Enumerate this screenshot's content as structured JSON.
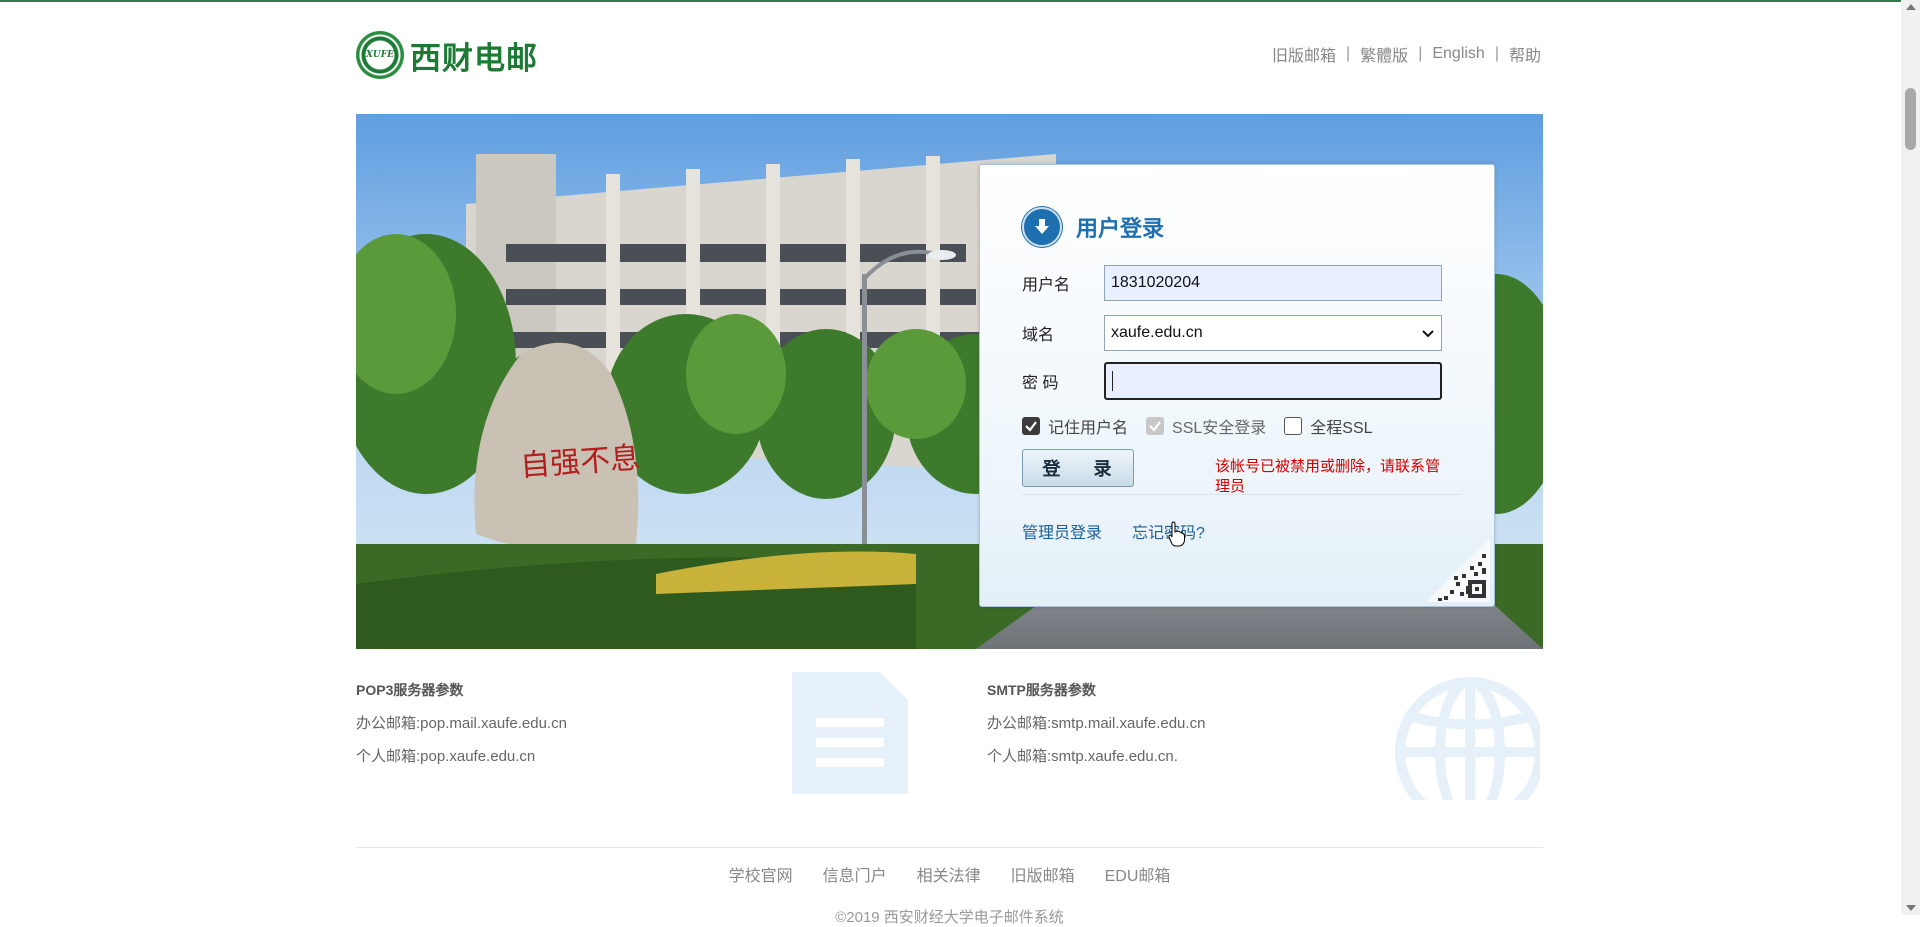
{
  "header": {
    "logo_abbr": "XUFE",
    "logo_text": "西财电邮",
    "links": [
      "旧版邮箱",
      "繁體版",
      "English",
      "帮助"
    ],
    "separator": "|"
  },
  "banner": {
    "stone_text": "自强不息"
  },
  "login": {
    "title": "用户登录",
    "username_label": "用户名",
    "username_value": "1831020204",
    "domain_label": "域名",
    "domain_value": "xaufe.edu.cn",
    "password_label": "密 码",
    "password_value": "",
    "checkboxes": [
      {
        "label": "记住用户名",
        "state": "checked"
      },
      {
        "label": "SSL安全登录",
        "state": "checked-disabled"
      },
      {
        "label": "全程SSL",
        "state": "unchecked"
      }
    ],
    "submit_label": "登 录",
    "error_message": "该帐号已被禁用或删除，请联系管理员",
    "admin_link": "管理员登录",
    "forgot_link": "忘记密码?"
  },
  "server_info": {
    "pop3": {
      "heading": "POP3服务器参数",
      "office": "办公邮箱:pop.mail.xaufe.edu.cn",
      "personal": "个人邮箱:pop.xaufe.edu.cn"
    },
    "smtp": {
      "heading": "SMTP服务器参数",
      "office": "办公邮箱:smtp.mail.xaufe.edu.cn",
      "personal": "个人邮箱:smtp.xaufe.edu.cn."
    }
  },
  "footer": {
    "links": [
      "学校官网",
      "信息门户",
      "相关法律",
      "旧版邮箱",
      "EDU邮箱"
    ],
    "copyright": "©2019 西安财经大学电子邮件系统"
  },
  "colors": {
    "brand_green": "#1d7a34",
    "login_blue": "#1e6fb0",
    "error_red": "#d40000"
  }
}
